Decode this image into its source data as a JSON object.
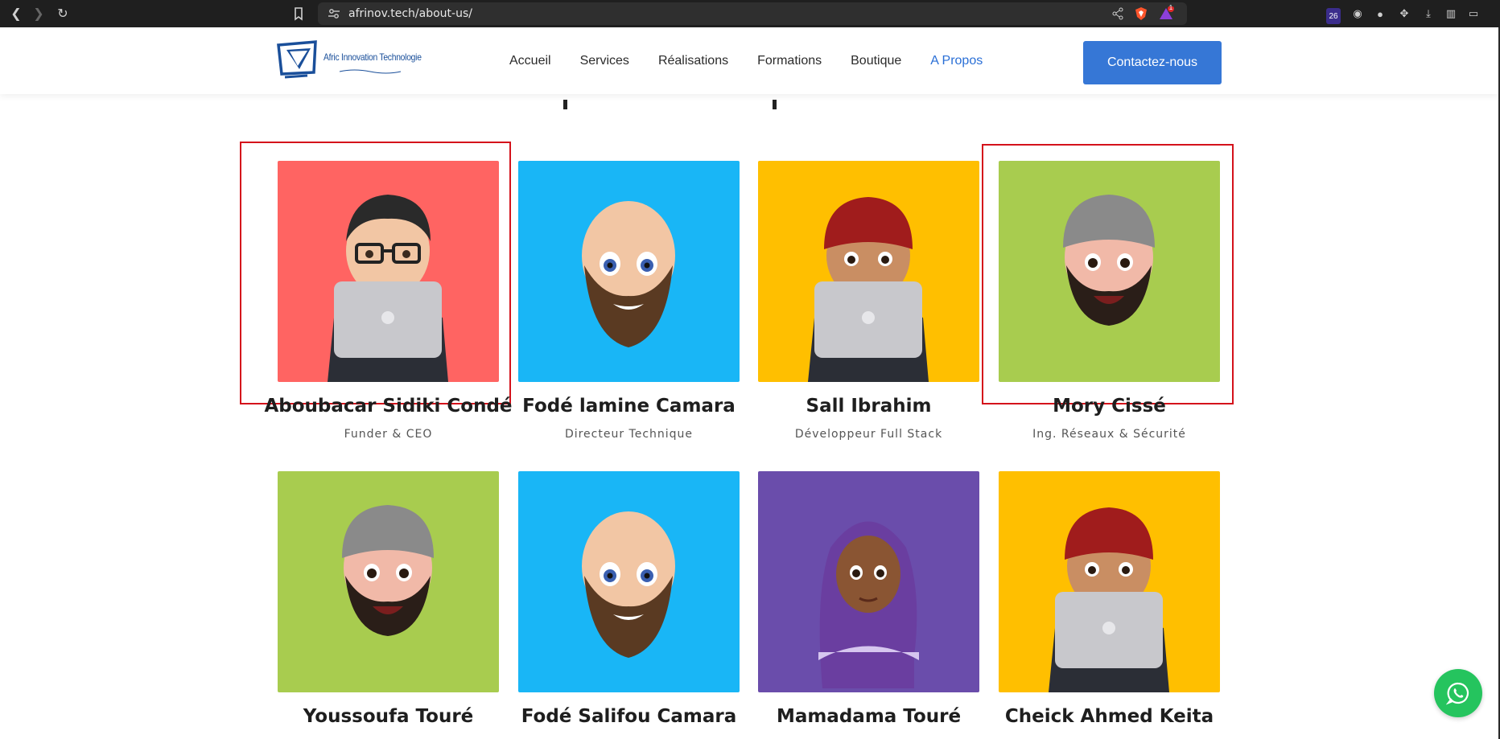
{
  "browser": {
    "url": "afrinov.tech/about-us/",
    "badge_count": "26",
    "alert_badge": "1"
  },
  "header": {
    "logo_text": "Afric Innovation Technologie",
    "nav": [
      {
        "label": "Accueil"
      },
      {
        "label": "Services"
      },
      {
        "label": "Réalisations"
      },
      {
        "label": "Formations"
      },
      {
        "label": "Boutique"
      },
      {
        "label": "A Propos",
        "active": true
      }
    ],
    "cta_label": "Contactez-nous"
  },
  "team": [
    {
      "name": "Aboubacar Sidiki Condé",
      "role": "Funder & CEO",
      "bg": "#ff6462",
      "avatar": "dev-glasses-laptop"
    },
    {
      "name": "Fodé lamine Camara",
      "role": "Directeur Technique",
      "bg": "#19b6f6",
      "avatar": "bald-beard"
    },
    {
      "name": "Sall Ibrahim",
      "role": "Développeur Full Stack",
      "bg": "#ffbf00",
      "avatar": "red-beanie-laptop"
    },
    {
      "name": "Mory Cissé",
      "role": "Ing. Réseaux & Sécurité",
      "bg": "#a8cc4f",
      "avatar": "gray-beanie-beard"
    },
    {
      "name": "Youssoufa Touré",
      "role": "",
      "bg": "#a8cc4f",
      "avatar": "gray-beanie-beard"
    },
    {
      "name": "Fodé Salifou Camara",
      "role": "",
      "bg": "#19b6f6",
      "avatar": "bald-beard"
    },
    {
      "name": "Mamadama Touré",
      "role": "",
      "bg": "#6a4dab",
      "avatar": "hijab"
    },
    {
      "name": "Cheick Ahmed Keita",
      "role": "",
      "bg": "#ffbf00",
      "avatar": "red-beanie-laptop"
    }
  ],
  "colors": {
    "accent": "#3677d6",
    "highlight": "#d4121b",
    "whatsapp": "#25c45e"
  }
}
